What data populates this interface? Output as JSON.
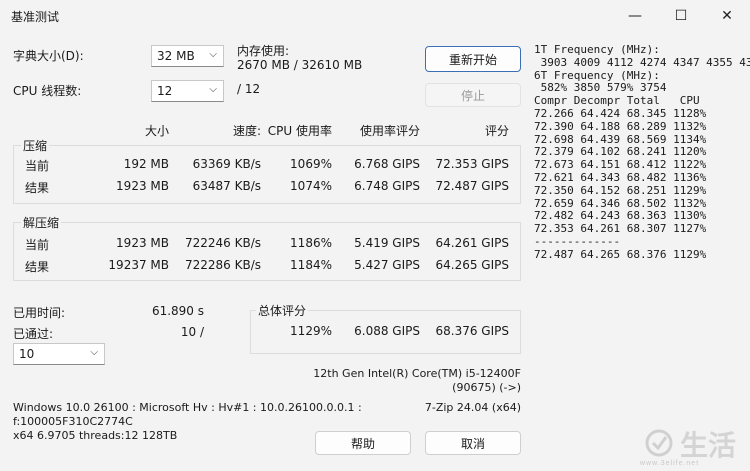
{
  "window": {
    "title": "基准测试",
    "minimize": "—",
    "maximize": "☐",
    "close": "✕"
  },
  "dict": {
    "label": "字典大小(D):",
    "value": "32 MB"
  },
  "memory": {
    "label": "内存使用:",
    "value": "2670 MB / 32610 MB"
  },
  "cpu_threads": {
    "label": "CPU 线程数:",
    "value": "12",
    "total": "/ 12"
  },
  "buttons": {
    "restart": "重新开始",
    "stop": "停止",
    "help": "帮助",
    "cancel": "取消"
  },
  "headers": {
    "size": "大小",
    "speed": "速度:",
    "cpu_usage": "CPU 使用率",
    "usage_rating": "使用率评分",
    "rating": "评分"
  },
  "compress": {
    "title": "压缩",
    "rows": [
      {
        "label": "当前",
        "size": "192 MB",
        "speed": "63369 KB/s",
        "cpu": "1069%",
        "usage_rating": "6.768 GIPS",
        "rating": "72.353 GIPS"
      },
      {
        "label": "结果",
        "size": "1923 MB",
        "speed": "63487 KB/s",
        "cpu": "1074%",
        "usage_rating": "6.748 GIPS",
        "rating": "72.487 GIPS"
      }
    ]
  },
  "decompress": {
    "title": "解压缩",
    "rows": [
      {
        "label": "当前",
        "size": "1923 MB",
        "speed": "722246 KB/s",
        "cpu": "1186%",
        "usage_rating": "5.419 GIPS",
        "rating": "64.261 GIPS"
      },
      {
        "label": "结果",
        "size": "19237 MB",
        "speed": "722286 KB/s",
        "cpu": "1184%",
        "usage_rating": "5.427 GIPS",
        "rating": "64.265 GIPS"
      }
    ]
  },
  "elapsed": {
    "label": "已用时间:",
    "value": "61.890 s"
  },
  "passed": {
    "label": "已通过:",
    "value": "10 /"
  },
  "passes_select": {
    "value": "10"
  },
  "total_rating": {
    "title": "总体评分",
    "cpu": "1129%",
    "usage_rating": "6.088 GIPS",
    "rating": "68.376 GIPS"
  },
  "cpu_info": {
    "name": "12th Gen Intel(R) Core(TM) i5-12400F",
    "id": "(90675) (->)"
  },
  "sys_info": {
    "line1": "Windows 10.0 26100 : Microsoft Hv : Hv#1 : 10.0.26100.0.0.1 :",
    "line2": "f:100005F310C2774C",
    "line3": "x64 6.9705 threads:12 128TB",
    "version": "7-Zip 24.04 (x64)"
  },
  "log": {
    "lines": [
      "1T Frequency (MHz):",
      " 3903 4009 4112 4274 4347 4355 4348",
      "6T Frequency (MHz):",
      " 582% 3850 579% 3754",
      "Compr Decompr Total   CPU",
      "72.266 64.424 68.345 1128%",
      "72.390 64.188 68.289 1132%",
      "72.698 64.439 68.569 1134%",
      "72.379 64.102 68.241 1120%",
      "72.673 64.151 68.412 1122%",
      "72.621 64.343 68.482 1136%",
      "72.350 64.152 68.251 1129%",
      "72.659 64.346 68.502 1132%",
      "72.482 64.243 68.363 1130%",
      "72.353 64.261 68.307 1127%",
      "-------------",
      "72.487 64.265 68.376 1129%"
    ]
  },
  "watermark": {
    "text": "生活",
    "url": "www.3elife.net"
  }
}
